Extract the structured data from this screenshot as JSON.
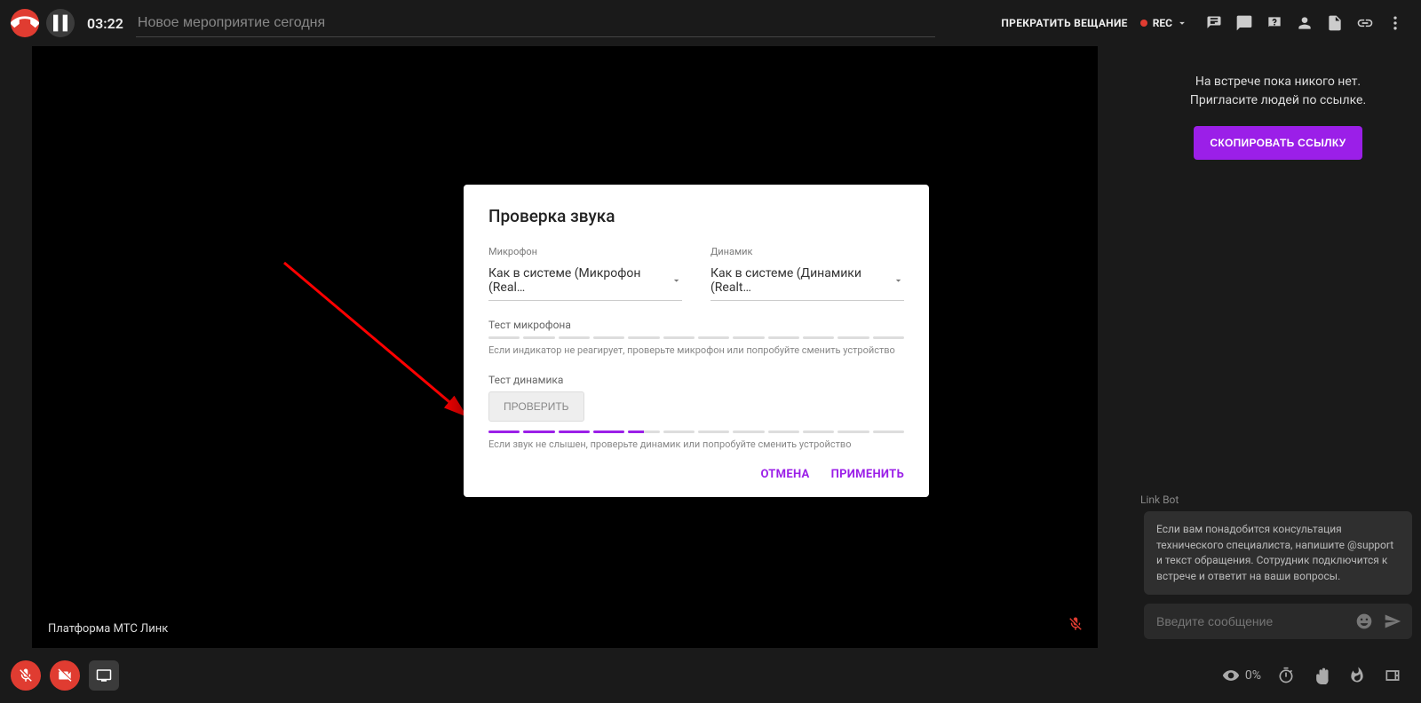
{
  "topbar": {
    "timer": "03:22",
    "title": "Новое мероприятие сегодня",
    "stop_broadcast": "ПРЕКРАТИТЬ ВЕЩАНИЕ",
    "rec": "REC"
  },
  "right": {
    "empty_line1": "На встрече пока никого нет.",
    "empty_line2": "Пригласите людей по ссылке.",
    "copy_link": "СКОПИРОВАТЬ ССЫЛКУ",
    "bot_author": "Link Bot",
    "bot_text": "Если вам понадобится консультация технического специалиста, напишите @support и текст обращения. Сотрудник подключится к встрече и ответит на ваши вопросы.",
    "chat_placeholder": "Введите сообщение"
  },
  "stage": {
    "watermark": "Платформа МТС Линк"
  },
  "bottom": {
    "visibility_pct": "0%"
  },
  "dialog": {
    "title": "Проверка звука",
    "mic_label": "Микрофон",
    "mic_value": "Как в системе (Микрофон (Real…",
    "spk_label": "Динамик",
    "spk_value": "Как в системе (Динамики (Realt…",
    "mic_test_label": "Тест микрофона",
    "mic_hint": "Если индикатор не реагирует, проверьте микрофон или попробуйте сменить устройство",
    "spk_test_label": "Тест динамика",
    "check_btn": "ПРОВЕРИТЬ",
    "spk_hint": "Если звук не слышен, проверьте динамик или попробуйте сменить устройство",
    "cancel": "ОТМЕНА",
    "apply": "ПРИМЕНИТЬ"
  }
}
